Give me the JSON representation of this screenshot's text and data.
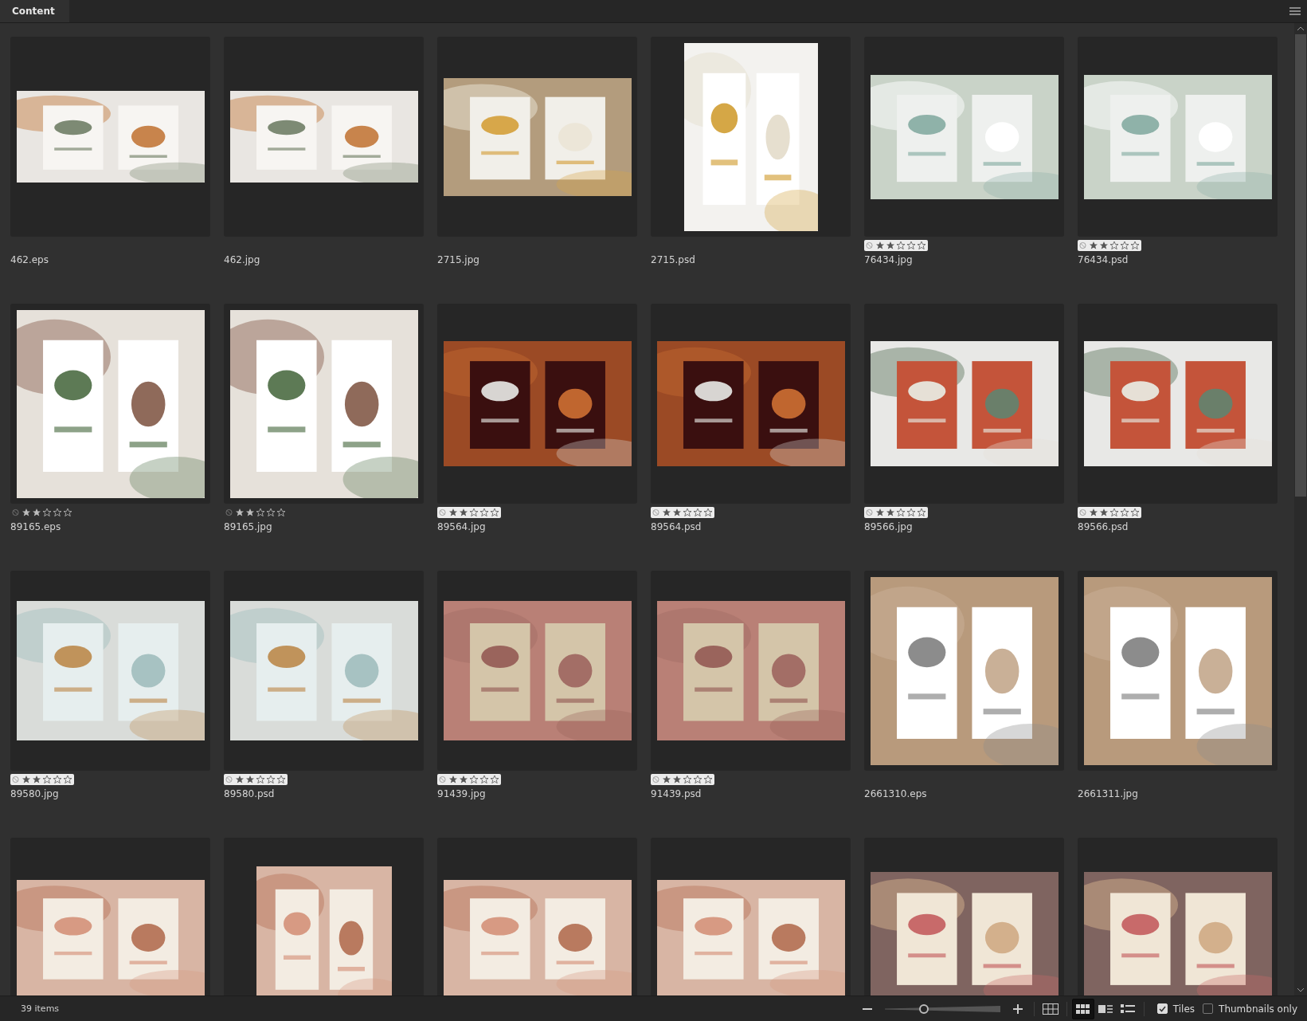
{
  "panel": {
    "tab": "Content"
  },
  "items": [
    {
      "kind": "picture",
      "name": "462.eps"
    },
    {
      "kind": "picture",
      "name": "462.jpg"
    },
    {
      "kind": "picture",
      "name": "2715.jpg"
    },
    {
      "kind": "picture",
      "name": "2715.psd"
    },
    {
      "kind": "picture",
      "name": "76434.jpg",
      "stars": 2,
      "highlighted": true
    },
    {
      "kind": "picture",
      "name": "76434.psd",
      "stars": 2,
      "highlighted": true
    },
    {
      "kind": "picture",
      "name": "89165.eps",
      "stars": 2,
      "highlighted": false
    },
    {
      "kind": "picture",
      "name": "89165.jpg",
      "stars": 2,
      "highlighted": false
    },
    {
      "kind": "picture",
      "name": "89564.jpg",
      "stars": 2,
      "highlighted": true
    },
    {
      "kind": "picture",
      "name": "89564.psd",
      "stars": 2,
      "highlighted": true
    },
    {
      "kind": "picture",
      "name": "89566.jpg",
      "stars": 2,
      "highlighted": true
    },
    {
      "kind": "picture",
      "name": "89566.psd",
      "stars": 2,
      "highlighted": true
    },
    {
      "kind": "picture",
      "name": "89580.jpg",
      "stars": 2,
      "highlighted": true
    },
    {
      "kind": "picture",
      "name": "89580.psd",
      "stars": 2,
      "highlighted": true
    },
    {
      "kind": "picture",
      "name": "91439.jpg",
      "stars": 2,
      "highlighted": true
    },
    {
      "kind": "picture",
      "name": "91439.psd",
      "stars": 2,
      "highlighted": true
    },
    {
      "kind": "picture",
      "name": "2661310.eps"
    },
    {
      "kind": "picture",
      "name": "2661311.jpg"
    },
    {
      "kind": "picture"
    },
    {
      "kind": "picture"
    },
    {
      "kind": "picture"
    },
    {
      "kind": "picture"
    },
    {
      "kind": "picture"
    },
    {
      "kind": "picture"
    }
  ],
  "status_bar": {
    "count": "39 items",
    "zoom": {
      "level": 0.34
    },
    "views": [
      {
        "kind": "grid",
        "selected": false
      },
      {
        "kind": "thumbs",
        "selected": true
      },
      {
        "kind": "details",
        "selected": false
      },
      {
        "kind": "list",
        "selected": false
      }
    ],
    "options": [
      {
        "label": "Tiles",
        "checked": true
      },
      {
        "label": "Thumbnails only",
        "checked": false
      }
    ]
  }
}
